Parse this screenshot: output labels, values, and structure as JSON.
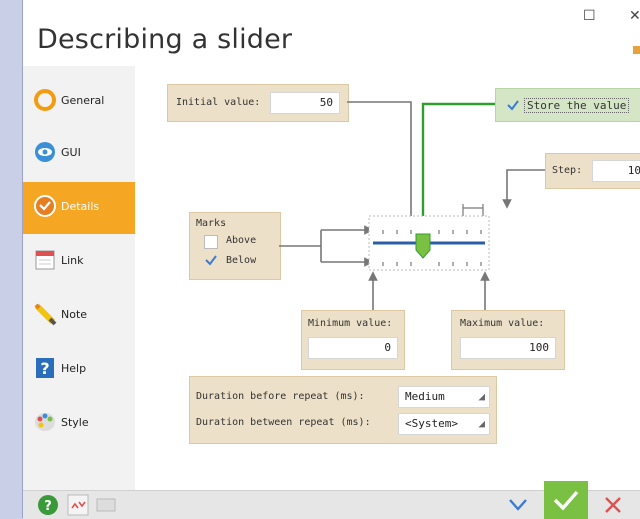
{
  "window": {
    "title": "Describing a slider"
  },
  "sidebar": {
    "items": [
      {
        "label": "General"
      },
      {
        "label": "GUI"
      },
      {
        "label": "Details"
      },
      {
        "label": "Link"
      },
      {
        "label": "Note"
      },
      {
        "label": "Help"
      },
      {
        "label": "Style"
      }
    ],
    "active": "Details"
  },
  "details": {
    "initial_value": {
      "label": "Initial value:",
      "value": "50"
    },
    "store_value": {
      "label": "Store the value",
      "checked": true
    },
    "step": {
      "label": "Step:",
      "value": "10"
    },
    "marks": {
      "title": "Marks",
      "above": {
        "label": "Above",
        "checked": false
      },
      "below": {
        "label": "Below",
        "checked": true
      }
    },
    "minimum": {
      "label": "Minimum value:",
      "value": "0"
    },
    "maximum": {
      "label": "Maximum value:",
      "value": "100"
    },
    "repeat": {
      "before_label": "Duration before repeat (ms):",
      "before_value": "Medium",
      "between_label": "Duration between repeat (ms):",
      "between_value": "<System>"
    }
  },
  "slider_preview": {
    "position_fraction": 0.5
  },
  "colors": {
    "accent_orange": "#f5a623",
    "panel_tan": "#ede0c8",
    "store_green": "#d4e6c6",
    "arrow_green": "#2e9e2e",
    "slider_blue": "#2a5ea8",
    "ok_green": "#7ac143",
    "cancel_red": "#e05050"
  }
}
